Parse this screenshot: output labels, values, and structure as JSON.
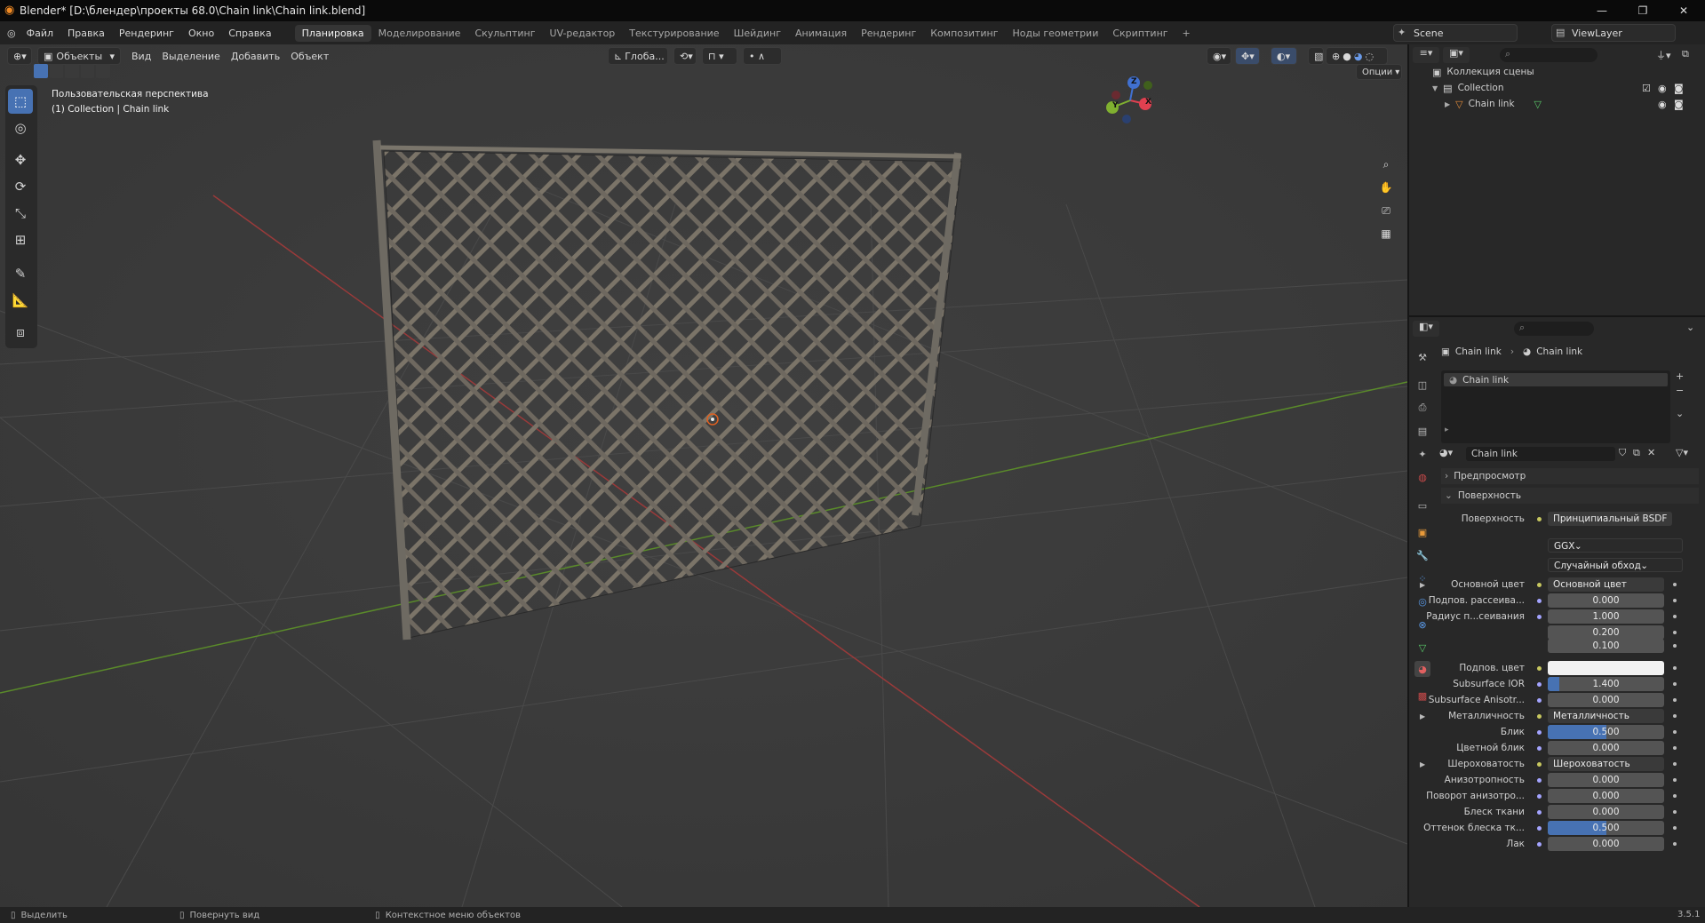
{
  "window": {
    "title": "Blender* [D:\\блендер\\проекты 68.0\\Chain link\\Chain link.blend]",
    "version": "3.5.1"
  },
  "menu": [
    "Файл",
    "Правка",
    "Рендеринг",
    "Окно",
    "Справка"
  ],
  "workspaces": [
    {
      "label": "Планировка",
      "active": true
    },
    {
      "label": "Моделирование"
    },
    {
      "label": "Скульптинг"
    },
    {
      "label": "UV-редактор"
    },
    {
      "label": "Текстурирование"
    },
    {
      "label": "Шейдинг"
    },
    {
      "label": "Анимация"
    },
    {
      "label": "Рендеринг"
    },
    {
      "label": "Композитинг"
    },
    {
      "label": "Ноды геометрии"
    },
    {
      "label": "Скриптинг"
    },
    {
      "label": "+"
    }
  ],
  "scene": {
    "scene_name": "Scene",
    "view_layer": "ViewLayer"
  },
  "viewport": {
    "mode": "Объекты",
    "menus": [
      "Вид",
      "Выделение",
      "Добавить",
      "Объект"
    ],
    "transform_orientation": "Глоба...",
    "options_label": "Опции",
    "overlay_title": "Пользовательская перспектива",
    "overlay_sub": "(1) Collection | Chain link",
    "gizmo": {
      "x": "X",
      "y": "Y",
      "z": "Z"
    }
  },
  "outliner": {
    "root": "Коллекция сцены",
    "items": [
      {
        "label": "Collection"
      },
      {
        "label": "Chain link"
      }
    ]
  },
  "properties": {
    "breadcrumb": [
      "Chain link",
      "Chain link"
    ],
    "slot": "Chain link",
    "material": "Chain link",
    "panels": {
      "preview": "Предпросмотр",
      "surface": "Поверхность"
    },
    "surface_row": {
      "label": "Поверхность",
      "value": "Принципиальный BSDF"
    },
    "distribution": "GGX",
    "subsurface_method": "Случайный обход",
    "rows": [
      {
        "label": "Основной цвет",
        "value": "Основной цвет",
        "kind": "link",
        "arrow": true
      },
      {
        "label": "Подпов. рассеива...",
        "value": "0.000",
        "kind": "num",
        "fill": 0
      },
      {
        "label": "Радиус п...сеивания",
        "value": "1.000",
        "kind": "num",
        "fill": 0
      },
      {
        "label": "",
        "value": "0.200",
        "kind": "num",
        "fill": 0
      },
      {
        "label": "",
        "value": "0.100",
        "kind": "num",
        "fill": 0
      },
      {
        "label": "Подпов. цвет",
        "value": "",
        "kind": "color"
      },
      {
        "label": "Subsurface IOR",
        "value": "1.400",
        "kind": "num",
        "fill": 0.1
      },
      {
        "label": "Subsurface Anisotr...",
        "value": "0.000",
        "kind": "num",
        "fill": 0
      },
      {
        "label": "Металличность",
        "value": "Металличность",
        "kind": "link",
        "arrow": true
      },
      {
        "label": "Блик",
        "value": "0.500",
        "kind": "num",
        "fill": 0.5
      },
      {
        "label": "Цветной блик",
        "value": "0.000",
        "kind": "num",
        "fill": 0
      },
      {
        "label": "Шероховатость",
        "value": "Шероховатость",
        "kind": "link",
        "arrow": true
      },
      {
        "label": "Анизотропность",
        "value": "0.000",
        "kind": "num",
        "fill": 0
      },
      {
        "label": "Поворот анизотро...",
        "value": "0.000",
        "kind": "num",
        "fill": 0
      },
      {
        "label": "Блеск ткани",
        "value": "0.000",
        "kind": "num",
        "fill": 0
      },
      {
        "label": "Оттенок блеска тк...",
        "value": "0.500",
        "kind": "num",
        "fill": 0.5
      },
      {
        "label": "Лак",
        "value": "0.000",
        "kind": "num",
        "fill": 0
      }
    ]
  },
  "status": {
    "select": "Выделить",
    "rotate": "Повернуть вид",
    "context": "Контекстное меню объектов"
  }
}
